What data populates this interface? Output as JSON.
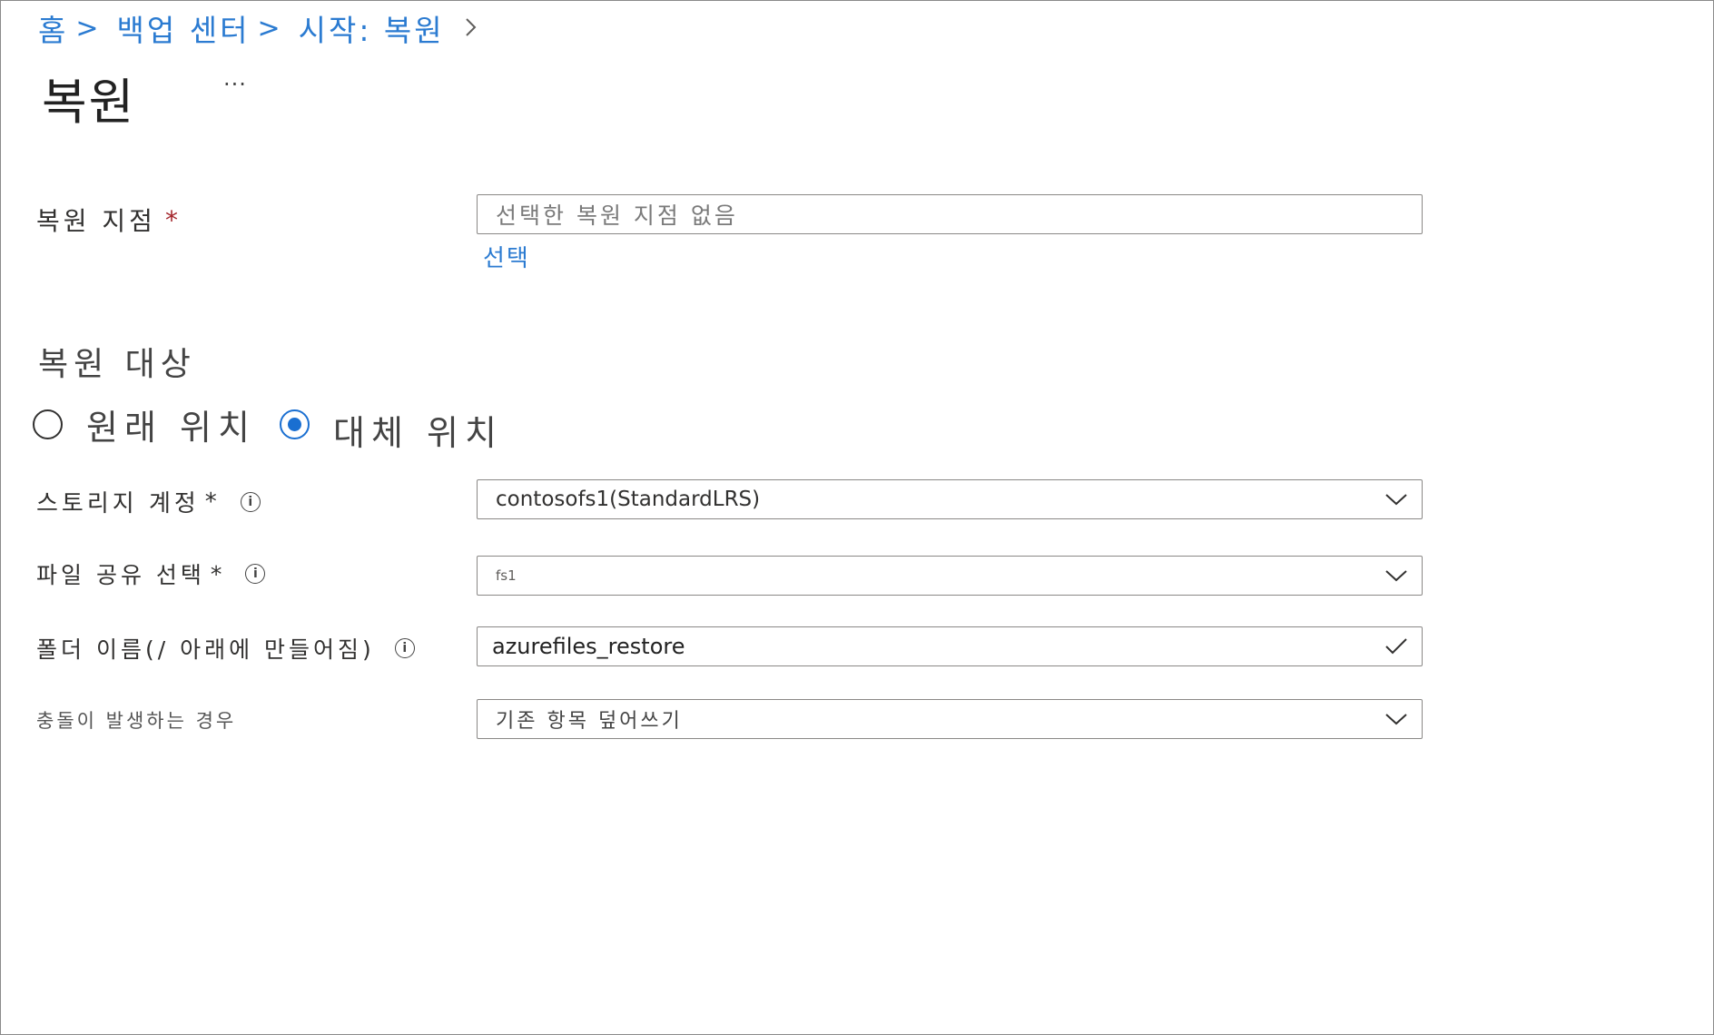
{
  "breadcrumb": {
    "home": "홈",
    "backup_center": "백업 센터",
    "start_restore": "시작: 복원",
    "separator": ">"
  },
  "page": {
    "title": "복원",
    "more": "..."
  },
  "restore_point": {
    "label": "복원 지점",
    "required_mark": "*",
    "placeholder": "선택한 복원 지점 없음",
    "select_link": "선택"
  },
  "restore_target": {
    "heading": "복원 대상",
    "options": [
      {
        "label": "원래 위치",
        "selected": false
      },
      {
        "label": "대체 위치",
        "selected": true
      }
    ]
  },
  "storage_account": {
    "label": "스토리지 계정",
    "required_mark": "*",
    "value": "contosofs1(StandardLRS)"
  },
  "file_share": {
    "label": "파일 공유 선택",
    "required_mark": "*",
    "value": "fs1"
  },
  "folder_name": {
    "label": "폴더 이름(/ 아래에 만들어짐)",
    "value": "azurefiles_restore"
  },
  "conflict": {
    "label": "충돌이 발생하는 경우",
    "value": "기존 항목 덮어쓰기"
  },
  "icons": {
    "info": "info-icon",
    "dropdown": "chevron-down-icon",
    "valid": "checkmark-icon",
    "crumb_chevron": "chevron-right-icon"
  },
  "colors": {
    "link": "#2b7bd1",
    "required": "#a4262c",
    "radio_selected": "#1a6fd1"
  }
}
